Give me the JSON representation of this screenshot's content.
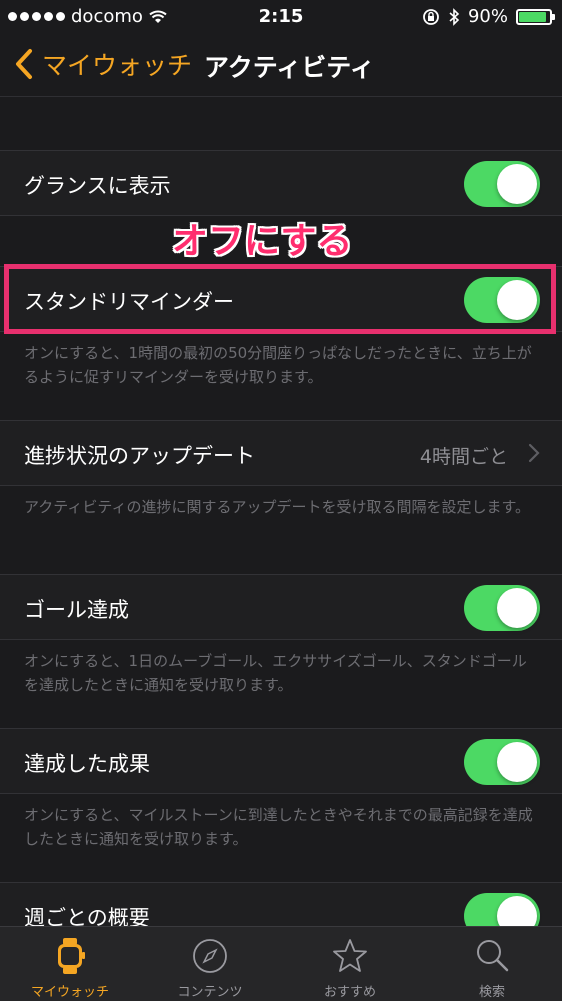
{
  "status_bar": {
    "carrier": "docomo",
    "time": "2:15",
    "battery_percent": "90%",
    "battery_level": 0.9
  },
  "nav": {
    "back_label": "マイウォッチ",
    "title": "アクティビティ"
  },
  "annotation": {
    "text": "オフにする",
    "color": "#ff2d6e"
  },
  "rows": [
    {
      "label": "グランスに表示",
      "toggle_on": true
    },
    {
      "label": "スタンドリマインダー",
      "toggle_on": true,
      "footer": "オンにすると、1時間の最初の50分間座りっぱなしだったときに、立ち上がるように促すリマインダーを受け取ります。"
    },
    {
      "label": "進捗状況のアップデート",
      "value": "4時間ごと",
      "footer": "アクティビティの進捗に関するアップデートを受け取る間隔を設定します。"
    },
    {
      "label": "ゴール達成",
      "toggle_on": true,
      "footer": "オンにすると、1日のムーブゴール、エクササイズゴール、スタンドゴールを達成したときに通知を受け取ります。"
    },
    {
      "label": "達成した成果",
      "toggle_on": true,
      "footer": "オンにすると、マイルストーンに到達したときやそれまでの最高記録を達成したときに通知を受け取ります。"
    },
    {
      "label": "週ごとの概要",
      "toggle_on": true
    }
  ],
  "tabs": [
    {
      "label": "マイウォッチ",
      "icon": "watch-icon",
      "active": true
    },
    {
      "label": "コンテンツ",
      "icon": "compass-icon",
      "active": false
    },
    {
      "label": "おすすめ",
      "icon": "star-icon",
      "active": false
    },
    {
      "label": "検索",
      "icon": "search-icon",
      "active": false
    }
  ],
  "colors": {
    "accent": "#f5a623",
    "toggle_on": "#4cd964",
    "annotation_box": "#e8306e"
  }
}
